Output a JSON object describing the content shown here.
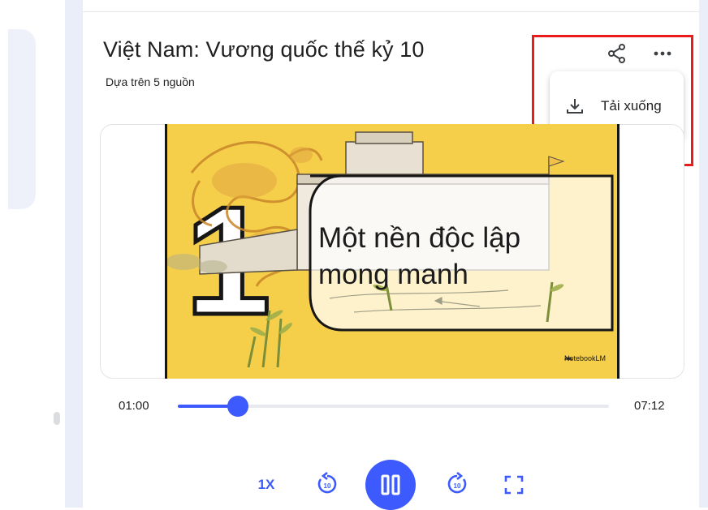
{
  "header": {
    "title": "Việt Nam: Vương quốc thế kỷ 10",
    "subtitle": "Dựa trên 5 nguồn"
  },
  "actions": {
    "share_icon": "share-icon",
    "more_icon": "more-horizontal-icon"
  },
  "menu": {
    "items": [
      {
        "label": "Tải xuống",
        "icon": "download-icon"
      }
    ]
  },
  "slide": {
    "number": "1",
    "lines": [
      "Một nền độc lập",
      "mong manh"
    ],
    "badge": "NotebookLM"
  },
  "player": {
    "current_time": "01:00",
    "total_time": "07:12",
    "progress": 0.139,
    "speed_label": "1X",
    "skip_seconds_label": "10",
    "state": "playing"
  },
  "colors": {
    "accent": "#3d5afe",
    "highlight": "#ea1b1b",
    "slide_bg": "#f6cf4a"
  }
}
